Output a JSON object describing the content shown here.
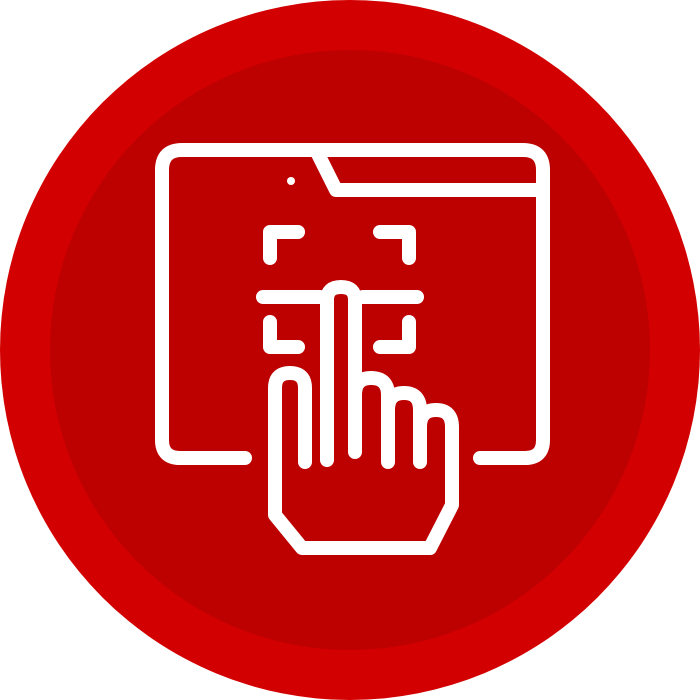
{
  "icon": {
    "name": "biometric-touch-scan-icon",
    "parts": [
      "browser-window-icon",
      "fingerprint-scan-frame-icon",
      "pointing-finger-icon"
    ]
  },
  "colors": {
    "outer_circle": "#d20000",
    "inner_circle": "#bd0000",
    "glyph": "#ffffff"
  }
}
